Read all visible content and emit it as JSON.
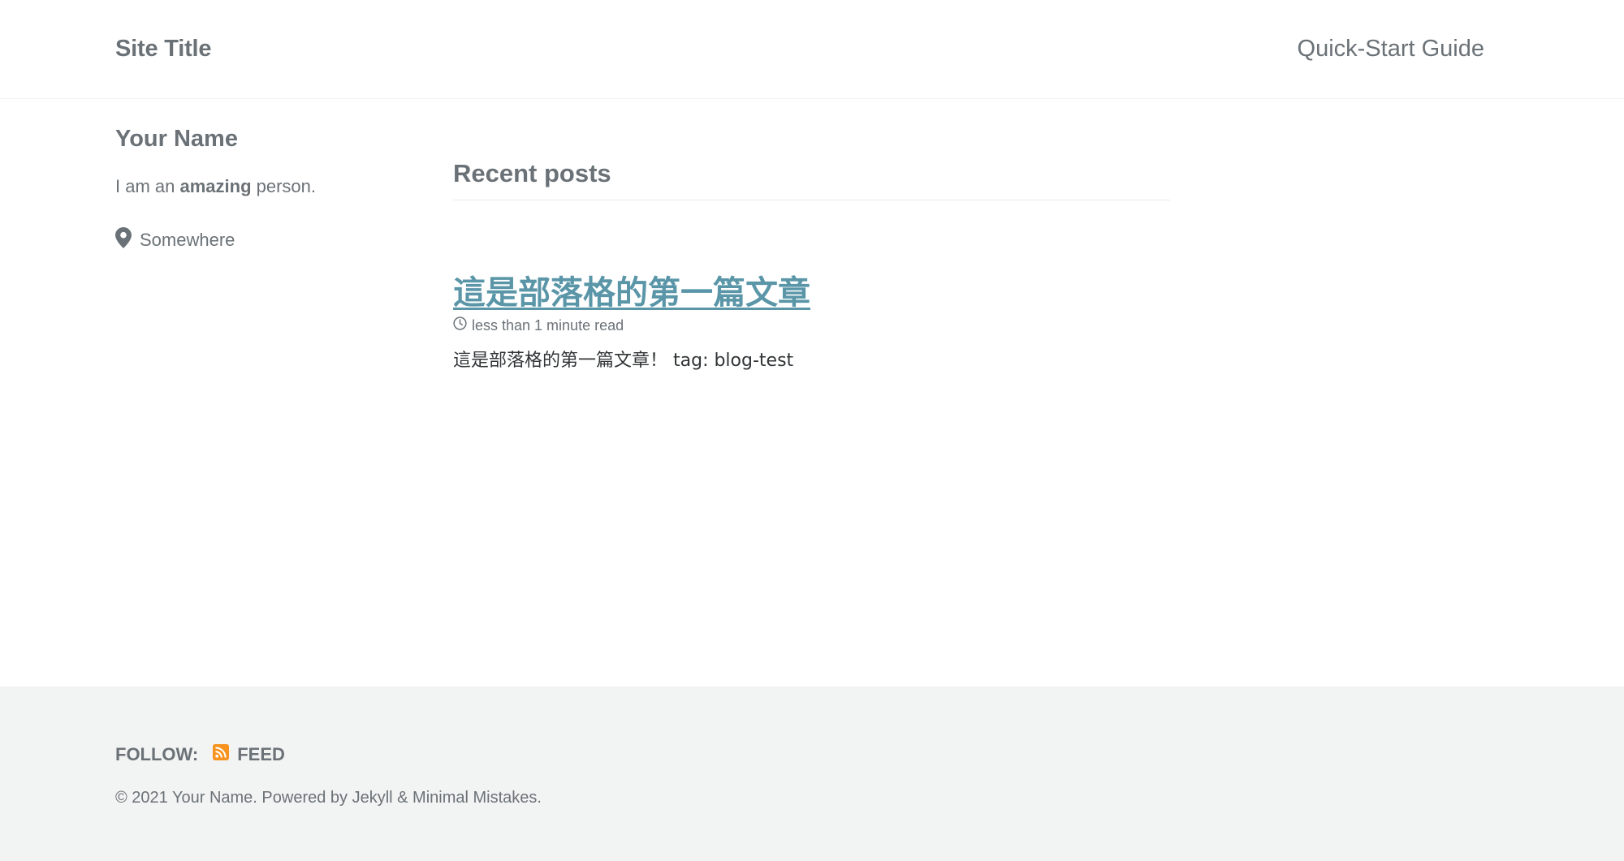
{
  "masthead": {
    "site_title": "Site Title",
    "nav": [
      {
        "label": "Quick-Start Guide"
      }
    ]
  },
  "author": {
    "name": "Your Name",
    "bio_prefix": "I am an ",
    "bio_emphasis": "amazing",
    "bio_suffix": " person.",
    "location_icon": "map-marker-icon",
    "location": "Somewhere"
  },
  "main": {
    "section_title": "Recent posts",
    "posts": [
      {
        "title": "這是部落格的第一篇文章",
        "read_time_icon": "clock-icon",
        "read_time": "less than 1 minute read",
        "excerpt": "這是部落格的第一篇文章！ tag: blog-test"
      }
    ]
  },
  "footer": {
    "follow_label": "FOLLOW:",
    "feed_icon": "rss-icon",
    "feed_label": "FEED",
    "copyright": "© 2021 Your Name. Powered by Jekyll & Minimal Mistakes."
  },
  "colors": {
    "link": "#5a96a8",
    "text_muted": "#6b7277",
    "footer_bg": "#f2f3f3",
    "rss": "#f7931e"
  }
}
